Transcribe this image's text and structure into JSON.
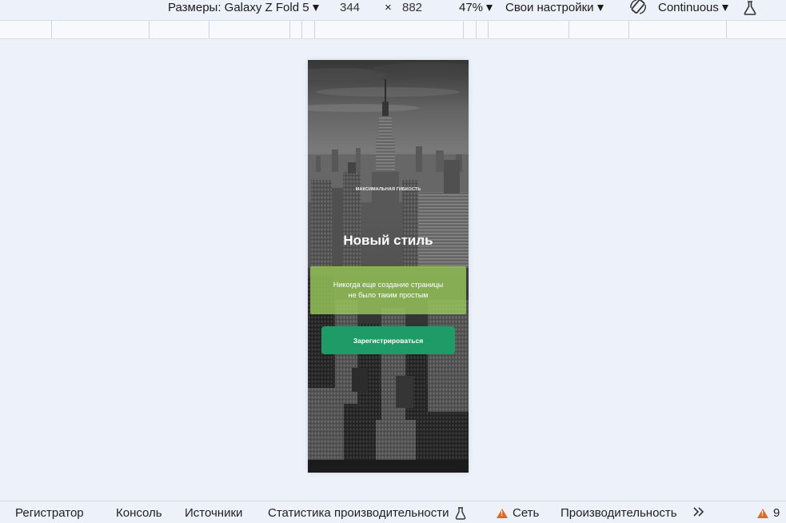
{
  "toolbar": {
    "dimensions_label": "Размеры: Galaxy Z Fold 5",
    "width_value": "344",
    "times_sign": "×",
    "height_value": "882",
    "zoom_value": "47%",
    "throttle_label": "Свои настройки",
    "rotate_icon": "rotate-device-icon",
    "mode_label": "Continuous",
    "sensor_icon": "flask-icon"
  },
  "hero": {
    "kicker": "МАКСИМАЛЬНАЯ ГИБКОСТЬ",
    "headline": "Новый стиль",
    "tagline_line1": "Никогда еще создание страницы",
    "tagline_line2": "не было таким простым",
    "cta_label": "Зарегистрироваться",
    "background_image": "grayscale-city-skyline-photo",
    "accent_green": "#97c75a",
    "cta_color": "#1e9b67"
  },
  "devtools_tabs": {
    "recorder": "Регистратор",
    "console": "Консоль",
    "sources": "Источники",
    "perf_insights": "Статистика производительности",
    "network": "Сеть",
    "performance": "Производительность",
    "more_icon": "chevrons-right-icon",
    "warnings_count": "9"
  }
}
